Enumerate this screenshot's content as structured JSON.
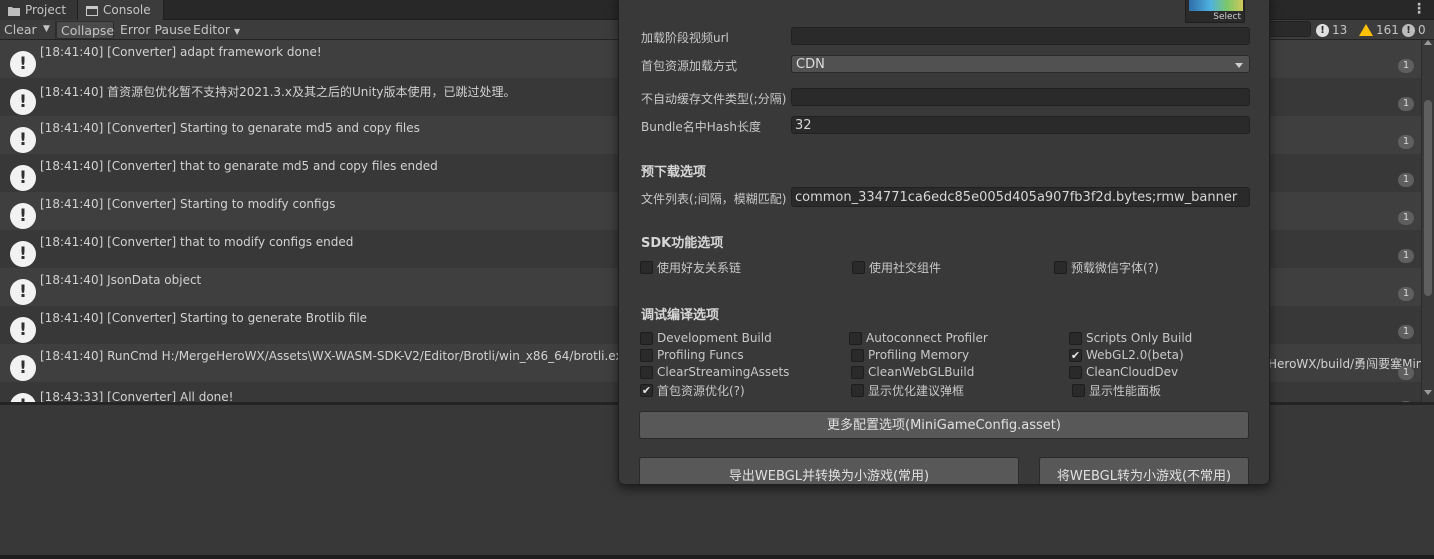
{
  "tabs": [
    {
      "label": "Project",
      "icon": "folder-icon"
    },
    {
      "label": "Console",
      "icon": "console-icon"
    }
  ],
  "toolbar": {
    "clear": "Clear",
    "collapse": "Collapse",
    "error_pause": "Error Pause",
    "editor": "Editor",
    "info_count": "13",
    "warn_count": "161",
    "error_count": "0"
  },
  "logs": [
    {
      "text": "[18:41:40] [Converter]  adapt framework done!",
      "count": "1"
    },
    {
      "text": "[18:41:40] 首资源包优化暂不支持对2021.3.x及其之后的Unity版本使用，已跳过处理。",
      "count": "1"
    },
    {
      "text": "[18:41:40] [Converter] Starting to genarate md5 and copy files",
      "count": "1"
    },
    {
      "text": "[18:41:40] [Converter] that to genarate md5 and copy files ended",
      "count": "1"
    },
    {
      "text": "[18:41:40] [Converter] Starting to modify configs",
      "count": "1"
    },
    {
      "text": "[18:41:40] [Converter] that to modify configs ended",
      "count": "1"
    },
    {
      "text": "[18:41:40] JsonData object",
      "count": "1"
    },
    {
      "text": "[18:41:40] [Converter] Starting to generate Brotlib file",
      "count": "1"
    },
    {
      "text": "[18:41:40] RunCmd H:/MergeHeroWX/Assets\\WX-WASM-SDK-V2/Editor/Brotli/win_x86_64/brotli.exe  --",
      "tail": "HeroWX/build/勇闯要塞Mini",
      "count": "1"
    },
    {
      "text": "[18:43:33] [Converter] All done!",
      "count": "1"
    }
  ],
  "panel": {
    "thumb_label": "Select",
    "fields": {
      "video_url_label": "加载阶段视频url",
      "video_url_value": "",
      "load_method_label": "首包资源加载方式",
      "load_method_value": "CDN",
      "no_cache_label": "不自动缓存文件类型(;分隔)",
      "no_cache_value": "",
      "hash_len_label": "Bundle名中Hash长度",
      "hash_len_value": "32"
    },
    "preload_section": "预下载选项",
    "preload_label": "文件列表(;间隔，模糊匹配)",
    "preload_value": "common_334771ca6edc85e005d405a907fb3f2d.bytes;rmw_banner",
    "sdk_section": "SDK功能选项",
    "sdk_options": [
      {
        "label": "使用好友关系链",
        "checked": false
      },
      {
        "label": "使用社交组件",
        "checked": false
      },
      {
        "label": "预载微信字体(?)",
        "checked": false
      }
    ],
    "debug_section": "调试编译选项",
    "debug_options": [
      {
        "label": "Development Build",
        "checked": false
      },
      {
        "label": "Autoconnect Profiler",
        "checked": false
      },
      {
        "label": "Scripts Only Build",
        "checked": false
      },
      {
        "label": "Profiling Funcs",
        "checked": false
      },
      {
        "label": "Profiling Memory",
        "checked": false
      },
      {
        "label": "WebGL2.0(beta)",
        "checked": true
      },
      {
        "label": "ClearStreamingAssets",
        "checked": false
      },
      {
        "label": "CleanWebGLBuild",
        "checked": false
      },
      {
        "label": "CleanCloudDev",
        "checked": false
      },
      {
        "label": "首包资源优化(?)",
        "checked": true
      },
      {
        "label": "显示优化建议弹框",
        "checked": false
      },
      {
        "label": "显示性能面板",
        "checked": false
      }
    ],
    "more_config_button": "更多配置选项(MiniGameConfig.asset)",
    "export_button": "导出WEBGL并转换为小游戏(常用)",
    "convert_button": "将WEBGL转为小游戏(不常用)"
  }
}
